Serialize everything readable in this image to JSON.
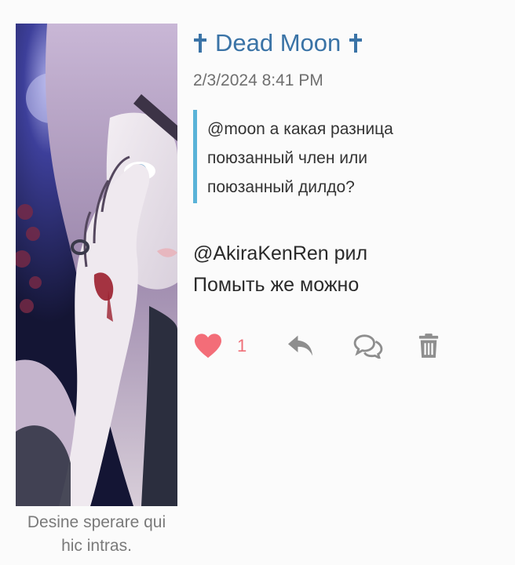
{
  "avatar": {
    "caption": "Desine sperare qui hic intras."
  },
  "post": {
    "author": "Dead Moon",
    "author_prefix_icon": "latin-cross-icon",
    "author_suffix_icon": "latin-cross-icon",
    "timestamp": "2/3/2024 8:41 PM",
    "quote": {
      "text_line1": "@moon а какая разница",
      "text_line2": "поюзанный член или",
      "text_line3": "поюзанный дилдо?"
    },
    "message": {
      "line1": "@AkiraKenRen рил",
      "line2": "Помыть же можно"
    }
  },
  "actions": {
    "like_count": "1",
    "like_icon": "heart-icon",
    "reply_icon": "reply-icon",
    "comment_icon": "comments-icon",
    "delete_icon": "trash-icon"
  },
  "colors": {
    "author": "#3a73a6",
    "quote_bar": "#5ab3d8",
    "like": "#f36d78",
    "icon_gray": "#8e8e8e"
  }
}
